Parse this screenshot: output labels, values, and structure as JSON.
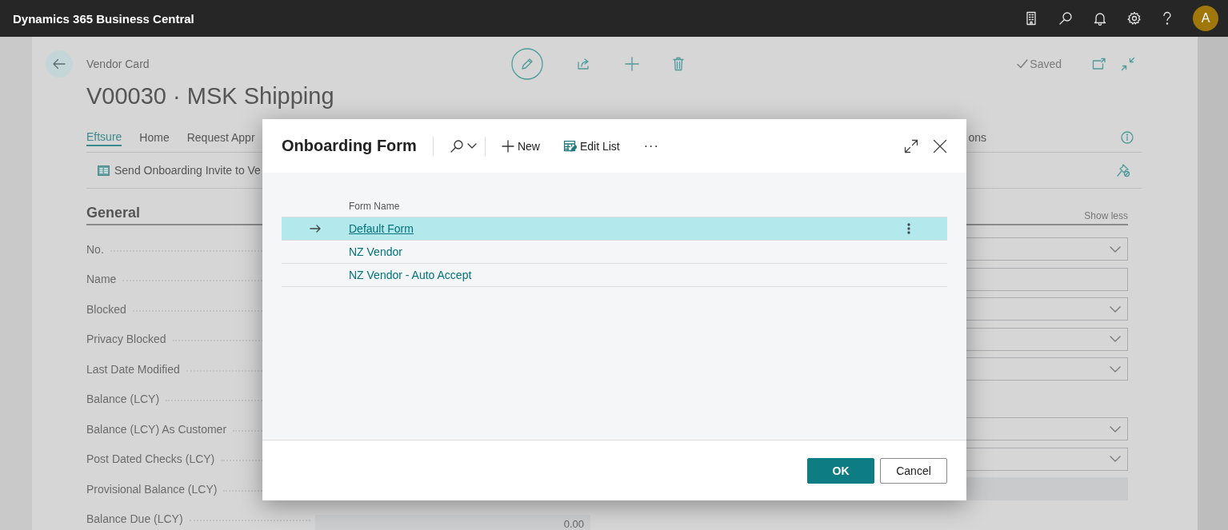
{
  "app_bar": {
    "title": "Dynamics 365 Business Central",
    "avatar": "A"
  },
  "page": {
    "caption": "Vendor Card",
    "title": "V00030 · MSK Shipping",
    "status": "Saved",
    "tabs": [
      {
        "label": "Eftsure",
        "selected": true
      },
      {
        "label": "Home",
        "selected": false
      },
      {
        "label": "Request Appr",
        "selected": false
      }
    ],
    "tabs_right_fragment": "ons",
    "actions": [
      {
        "label": "Send Onboarding Invite to Ve"
      }
    ],
    "section": {
      "title": "General",
      "toggle": "Show less",
      "left_fields": [
        {
          "label": "No."
        },
        {
          "label": "Name"
        },
        {
          "label": "Blocked"
        },
        {
          "label": "Privacy Blocked"
        },
        {
          "label": "Last Date Modified"
        },
        {
          "label": "Balance (LCY)"
        },
        {
          "label": "Balance (LCY) As Customer"
        },
        {
          "label": "Post Dated Checks (LCY)"
        },
        {
          "label": "Provisional Balance (LCY)"
        },
        {
          "label": "Balance Due (LCY)",
          "value": "0.00"
        }
      ],
      "right_fields": [
        {
          "kind": "dropdown"
        },
        {
          "kind": "text"
        },
        {
          "kind": "dropdown"
        },
        {
          "kind": "dropdown"
        },
        {
          "kind": "dropdown"
        },
        {
          "kind": "none"
        },
        {
          "kind": "dropdown"
        },
        {
          "kind": "dropdown"
        },
        {
          "kind": "readonly"
        }
      ]
    }
  },
  "dialog": {
    "title": "Onboarding Form",
    "toolbar": [
      {
        "kind": "search"
      },
      {
        "kind": "new",
        "label": "New"
      },
      {
        "kind": "edit_list",
        "label": "Edit List"
      },
      {
        "kind": "more",
        "label": "···"
      }
    ],
    "columns": [
      "Form Name"
    ],
    "rows": [
      {
        "form_name": "Default Form",
        "selected": true
      },
      {
        "form_name": "NZ Vendor",
        "selected": false
      },
      {
        "form_name": "NZ Vendor - Auto Accept",
        "selected": false
      }
    ],
    "buttons": [
      {
        "label": "OK",
        "kind": "primary"
      },
      {
        "label": "Cancel",
        "kind": "secondary"
      }
    ]
  }
}
